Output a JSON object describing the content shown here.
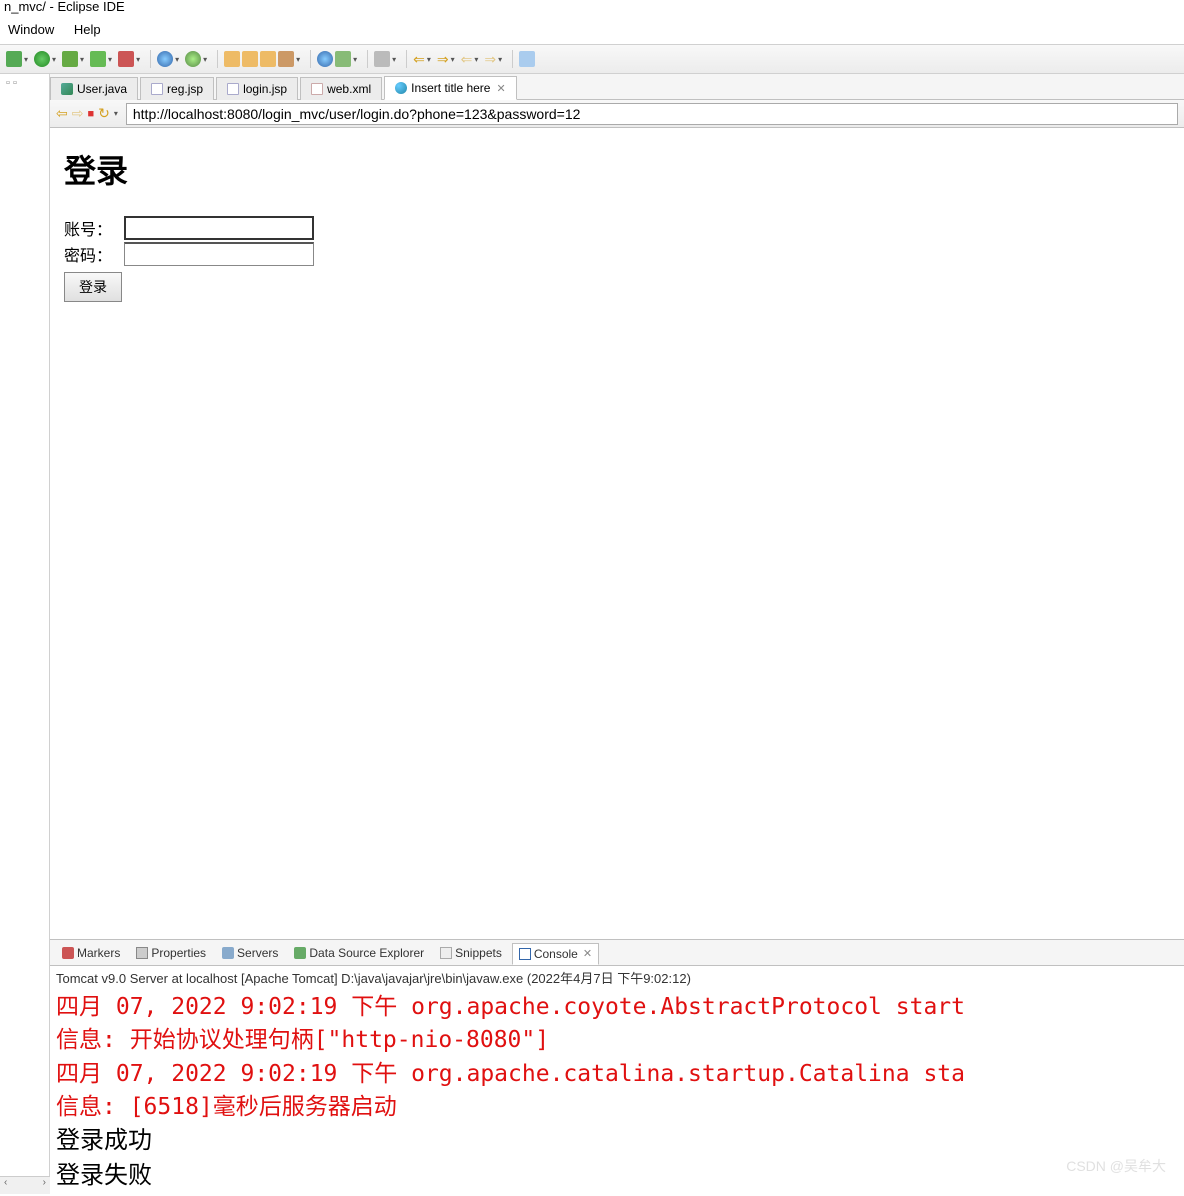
{
  "window": {
    "title": "n_mvc/ - Eclipse IDE"
  },
  "menu": {
    "window": "Window",
    "help": "Help"
  },
  "tabs": [
    {
      "label": "User.java",
      "icon": "java"
    },
    {
      "label": "reg.jsp",
      "icon": "jsp"
    },
    {
      "label": "login.jsp",
      "icon": "jsp"
    },
    {
      "label": "web.xml",
      "icon": "xml"
    },
    {
      "label": "Insert title here",
      "icon": "web",
      "active": true
    }
  ],
  "browser": {
    "url": "http://localhost:8080/login_mvc/user/login.do?phone=123&password=12"
  },
  "page": {
    "heading": "登录",
    "account_label": "账号：",
    "password_label": "密码：",
    "submit_label": "登录"
  },
  "bottom_tabs": {
    "markers": "Markers",
    "properties": "Properties",
    "servers": "Servers",
    "dse": "Data Source Explorer",
    "snippets": "Snippets",
    "console": "Console"
  },
  "console": {
    "header": "Tomcat v9.0 Server at localhost [Apache Tomcat] D:\\java\\javajar\\jre\\bin\\javaw.exe (2022年4月7日 下午9:02:12)",
    "line1": "四月 07, 2022 9:02:19 下午 org.apache.coyote.AbstractProtocol start",
    "line2": "信息: 开始协议处理句柄[\"http-nio-8080\"]",
    "line3": "四月 07, 2022 9:02:19 下午 org.apache.catalina.startup.Catalina sta",
    "line4": "信息: [6518]毫秒后服务器启动",
    "line5": "登录成功",
    "line6": "登录失败"
  },
  "watermark": "CSDN @吴牟大"
}
